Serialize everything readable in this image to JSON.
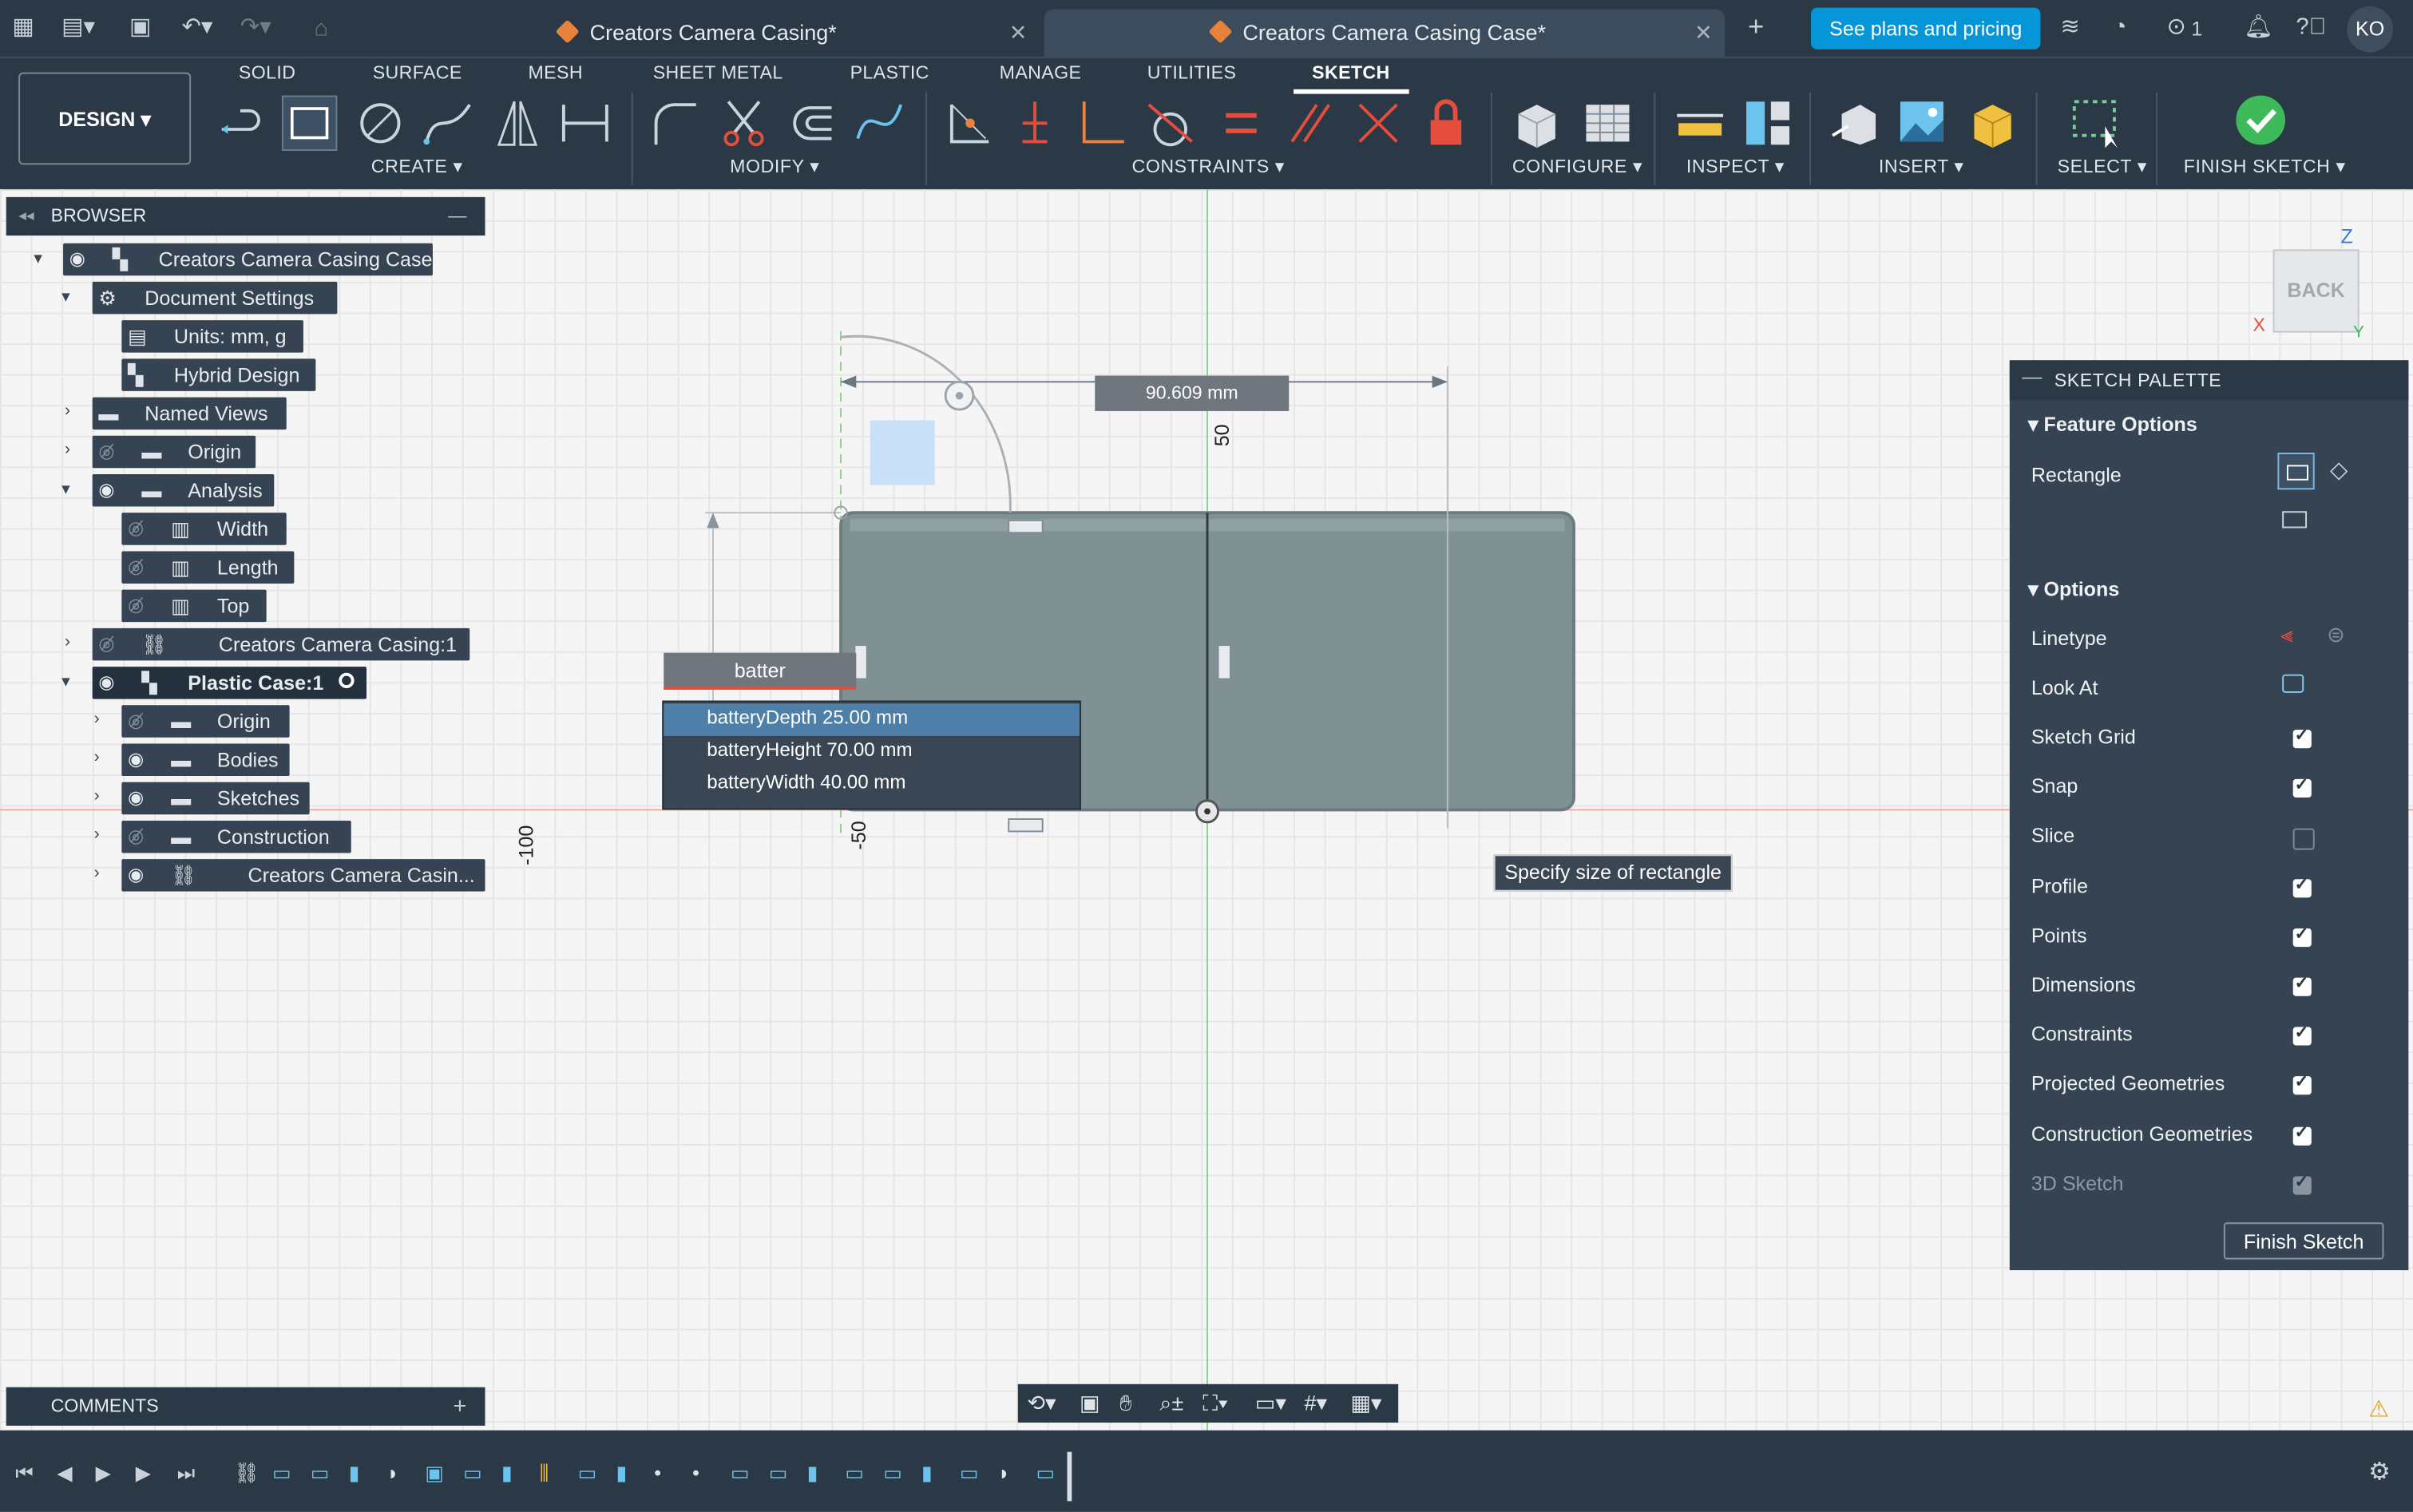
{
  "top_bar": {
    "tabs": [
      {
        "label": "Creators Camera Casing*",
        "active": false
      },
      {
        "label": "Creators Camera Casing Case*",
        "active": true
      }
    ],
    "plans_button": "See plans and pricing",
    "job_count": "1",
    "user_initials": "KO"
  },
  "ribbon": {
    "workspace": "DESIGN",
    "tabs": [
      "SOLID",
      "SURFACE",
      "MESH",
      "SHEET METAL",
      "PLASTIC",
      "MANAGE",
      "UTILITIES",
      "SKETCH"
    ],
    "active_tab": "SKETCH",
    "groups": [
      "CREATE",
      "MODIFY",
      "CONSTRAINTS",
      "CONFIGURE",
      "INSPECT",
      "INSERT",
      "SELECT",
      "FINISH SKETCH"
    ]
  },
  "browser": {
    "title": "BROWSER",
    "items": [
      {
        "label": "Creators Camera Casing Case"
      },
      {
        "label": "Document Settings"
      },
      {
        "label": "Units: mm, g"
      },
      {
        "label": "Hybrid Design"
      },
      {
        "label": "Named Views"
      },
      {
        "label": "Origin"
      },
      {
        "label": "Analysis"
      },
      {
        "label": "Width"
      },
      {
        "label": "Length"
      },
      {
        "label": "Top"
      },
      {
        "label": "Creators Camera Casing:1"
      },
      {
        "label": "Plastic Case:1"
      },
      {
        "label": "Origin"
      },
      {
        "label": "Bodies"
      },
      {
        "label": "Sketches"
      },
      {
        "label": "Construction"
      },
      {
        "label": "Creators Camera Casin..."
      }
    ]
  },
  "comments": {
    "title": "COMMENTS"
  },
  "canvas": {
    "dimension_value": "90.609 mm",
    "dimension_input": "batter",
    "autocomplete": [
      {
        "name": "batteryDepth",
        "value": "25.00 mm"
      },
      {
        "name": "batteryHeight",
        "value": "70.00 mm"
      },
      {
        "name": "batteryWidth",
        "value": "40.00 mm"
      }
    ],
    "ruler_labels": [
      "50",
      "-50",
      "-100"
    ],
    "tooltip": "Specify size of rectangle",
    "viewcube_face": "BACK",
    "axis_labels": {
      "z": "Z",
      "x": "X",
      "y": "Y"
    }
  },
  "sketch_palette": {
    "title": "SKETCH PALETTE",
    "feature_options": "Feature Options",
    "rectangle_label": "Rectangle",
    "options_label": "Options",
    "linetype": "Linetype",
    "look_at": "Look At",
    "toggles": [
      {
        "label": "Sketch Grid",
        "checked": true
      },
      {
        "label": "Snap",
        "checked": true
      },
      {
        "label": "Slice",
        "checked": false
      },
      {
        "label": "Profile",
        "checked": true
      },
      {
        "label": "Points",
        "checked": true
      },
      {
        "label": "Dimensions",
        "checked": true
      },
      {
        "label": "Constraints",
        "checked": true
      },
      {
        "label": "Projected Geometries",
        "checked": true
      },
      {
        "label": "Construction Geometries",
        "checked": true
      },
      {
        "label": "3D Sketch",
        "checked": true
      }
    ],
    "finish_button": "Finish Sketch"
  }
}
